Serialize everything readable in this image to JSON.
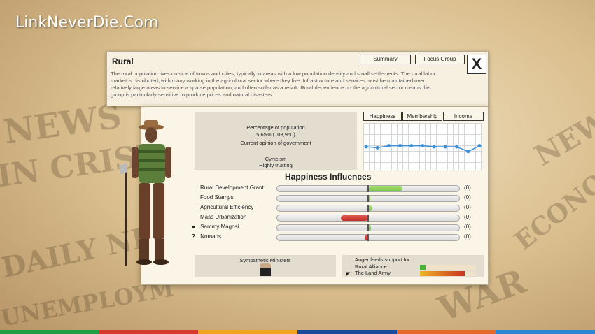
{
  "watermark": "LinkNeverDie.Com",
  "background_words": [
    "NEWS",
    "IN CRISIS",
    "DAILY NEWS",
    "UNEMPLOYM",
    "ECONOM",
    "WAR",
    "NEW"
  ],
  "group": {
    "title": "Rural",
    "description": "The rural population lives outside of towns and cities, typically in areas with a low population density and small settlements. The rural labor market is distributed, with many working in the agricultural sector where they live. Infrastructure and services must be maintained over relatively large areas to service a sparse population, and often suffer as a result. Rural dependence on the agricultural sector means this group is particularly sensitive to produce prices and natural disasters."
  },
  "tabs": {
    "summary": "Summary",
    "focus_group": "Focus Group",
    "close": "X"
  },
  "stats": {
    "percentage_label": "Percentage of population",
    "percentage_value": "5.65% (103,960)",
    "opinion_label": "Current opinion of government",
    "cynicism_label": "Cynicism",
    "cynicism_value": "Highly trusting"
  },
  "graph": {
    "tabs": [
      "Happiness",
      "Membership",
      "Income"
    ],
    "points": [
      0.5,
      0.48,
      0.52,
      0.52,
      0.52,
      0.52,
      0.5,
      0.5,
      0.5,
      0.4,
      0.52
    ],
    "line_color": "#3a8fd6"
  },
  "influences": {
    "title": "Happiness Influences",
    "rows": [
      {
        "label": "Rural Development Grant",
        "value": "(0)",
        "amount": 0.38,
        "icon": ""
      },
      {
        "label": "Food Stamps",
        "value": "(0)",
        "amount": 0.02,
        "icon": ""
      },
      {
        "label": "Agricultural Efficiency",
        "value": "(0)",
        "amount": 0.04,
        "icon": ""
      },
      {
        "label": "Mass Urbanization",
        "value": "(0)",
        "amount": -0.3,
        "icon": ""
      },
      {
        "label": "Sammy Magosi",
        "value": "(0)",
        "amount": 0.03,
        "icon": "person-icon"
      },
      {
        "label": "Nomads",
        "value": "(0)",
        "amount": -0.04,
        "icon": "question-icon"
      }
    ],
    "positive_color": "#7dc34a",
    "negative_color": "#c0302a"
  },
  "ministers": {
    "title": "Sympathetic Ministers"
  },
  "anger": {
    "title": "Anger feeds support for...",
    "rows": [
      {
        "label": "Rural Alliance",
        "level": 0.1,
        "flag": false
      },
      {
        "label": "The Land Army",
        "level": 0.8,
        "flag": true
      }
    ]
  },
  "colors": {
    "stripe": [
      "#1f9e45",
      "#d63a2f",
      "#f0a41f",
      "#1a4a9c",
      "#e4692a",
      "#2d86d2"
    ]
  }
}
